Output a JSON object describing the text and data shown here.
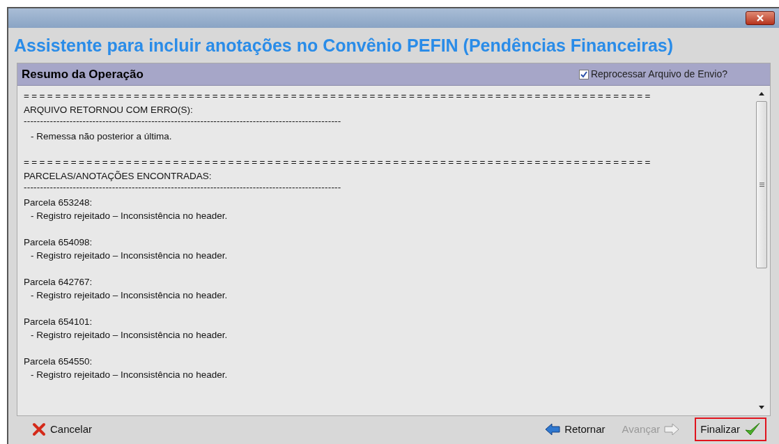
{
  "window": {
    "title": "Assistente para incluir anotações no Convênio PEFIN (Pendências Financeiras)"
  },
  "panel": {
    "title": "Resumo da Operação",
    "reprocess": {
      "label": "Reprocessar Arquivo de Envio?",
      "checked": true
    }
  },
  "log": [
    {
      "kind": "rule",
      "text": "================================================================================"
    },
    {
      "kind": "heading",
      "text": "ARQUIVO RETORNOU COM ERRO(S):"
    },
    {
      "kind": "dashes",
      "text": "-------------------------------------------------------------------------------------------------"
    },
    {
      "kind": "item",
      "text": "- Remessa não posterior a última."
    },
    {
      "kind": "gap"
    },
    {
      "kind": "rule",
      "text": "================================================================================"
    },
    {
      "kind": "heading",
      "text": "PARCELAS/ANOTAÇÕES ENCONTRADAS:"
    },
    {
      "kind": "dashes",
      "text": "-------------------------------------------------------------------------------------------------"
    },
    {
      "kind": "heading",
      "text": "Parcela 653248:"
    },
    {
      "kind": "item",
      "text": "- Registro rejeitado – Inconsistência no header."
    },
    {
      "kind": "gap"
    },
    {
      "kind": "heading",
      "text": "Parcela 654098:"
    },
    {
      "kind": "item",
      "text": "- Registro rejeitado – Inconsistência no header."
    },
    {
      "kind": "gap"
    },
    {
      "kind": "heading",
      "text": "Parcela 642767:"
    },
    {
      "kind": "item",
      "text": "- Registro rejeitado – Inconsistência no header."
    },
    {
      "kind": "gap"
    },
    {
      "kind": "heading",
      "text": "Parcela 654101:"
    },
    {
      "kind": "item",
      "text": "- Registro rejeitado – Inconsistência no header."
    },
    {
      "kind": "gap"
    },
    {
      "kind": "heading",
      "text": "Parcela 654550:"
    },
    {
      "kind": "item",
      "text": "- Registro rejeitado – Inconsistência no header."
    }
  ],
  "buttons": [
    {
      "kind": "cancel",
      "label": "Cancelar",
      "disabled": false,
      "highlighted": false
    },
    {
      "kind": "back",
      "label": "Retornar",
      "disabled": false,
      "highlighted": false
    },
    {
      "kind": "next",
      "label": "Avançar",
      "disabled": true,
      "highlighted": false
    },
    {
      "kind": "finish",
      "label": "Finalizar",
      "disabled": false,
      "highlighted": true
    }
  ]
}
